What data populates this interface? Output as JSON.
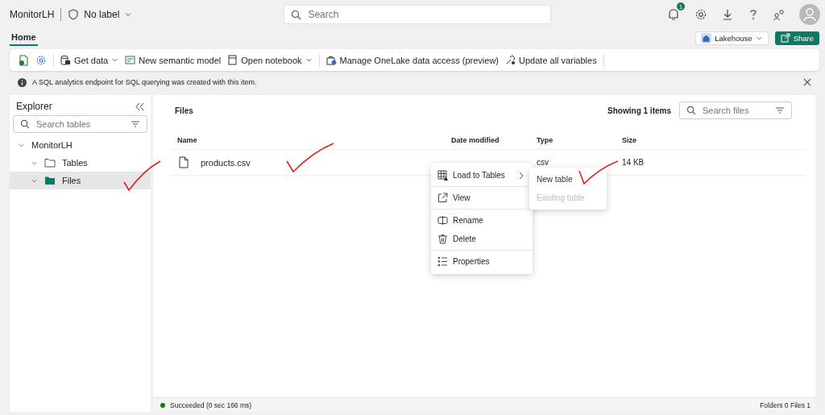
{
  "app_header": {
    "title": "MonitorLH",
    "sensitivity_label": "No label",
    "search": {
      "placeholder": "Search"
    },
    "notification_count": "1"
  },
  "ribbon": {
    "tabs": [
      {
        "label": "Home",
        "selected": true
      }
    ],
    "item_type": "Lakehouse",
    "share_button": "Share",
    "toolbar": [
      {
        "label": "Get data",
        "kind": "get-data",
        "dropdown": true
      },
      {
        "label": "New semantic model",
        "kind": "model",
        "dropdown": false
      },
      {
        "label": "Open notebook",
        "kind": "notebook",
        "dropdown": true
      },
      {
        "label": "Manage OneLake data access (preview)",
        "kind": "access",
        "dropdown": false
      },
      {
        "label": "Update all variables",
        "kind": "variables",
        "dropdown": false
      }
    ]
  },
  "info_bar": {
    "message": "A SQL analytics endpoint for SQL querying was created with this item."
  },
  "explorer": {
    "title": "Explorer",
    "search": {
      "placeholder": "Search tables"
    },
    "tree": [
      {
        "label": "MonitorLH",
        "selected": false,
        "children": [
          {
            "label": "Tables",
            "kind": "folder",
            "selected": false
          },
          {
            "label": "Files",
            "kind": "files",
            "selected": true
          }
        ]
      }
    ]
  },
  "files_pane": {
    "title": "Files",
    "count_label": "Showing 1 items",
    "search": {
      "placeholder": "Search files"
    },
    "columns": [
      "Name",
      "Date modified",
      "Type",
      "Size"
    ],
    "rows": [
      {
        "name": "products.csv",
        "type": "csv",
        "size": "14 KB"
      }
    ]
  },
  "context_menu": {
    "groups": [
      [
        {
          "label": "Load to Tables",
          "kind": "load",
          "submenu": true
        }
      ],
      [
        {
          "label": "View",
          "kind": "view",
          "submenu": false
        }
      ],
      [
        {
          "label": "Rename",
          "kind": "rename",
          "submenu": false
        },
        {
          "label": "Delete",
          "kind": "delete",
          "submenu": false
        }
      ],
      [
        {
          "label": "Properties",
          "kind": "properties",
          "submenu": false
        }
      ]
    ],
    "submenu": [
      {
        "label": "New table",
        "disabled": false
      },
      {
        "label": "Existing table",
        "disabled": true
      }
    ]
  },
  "status_bar": {
    "status": "Succeeded (0 sec 166 ms)",
    "success": true,
    "summary": "Folders 0 Files 1"
  }
}
